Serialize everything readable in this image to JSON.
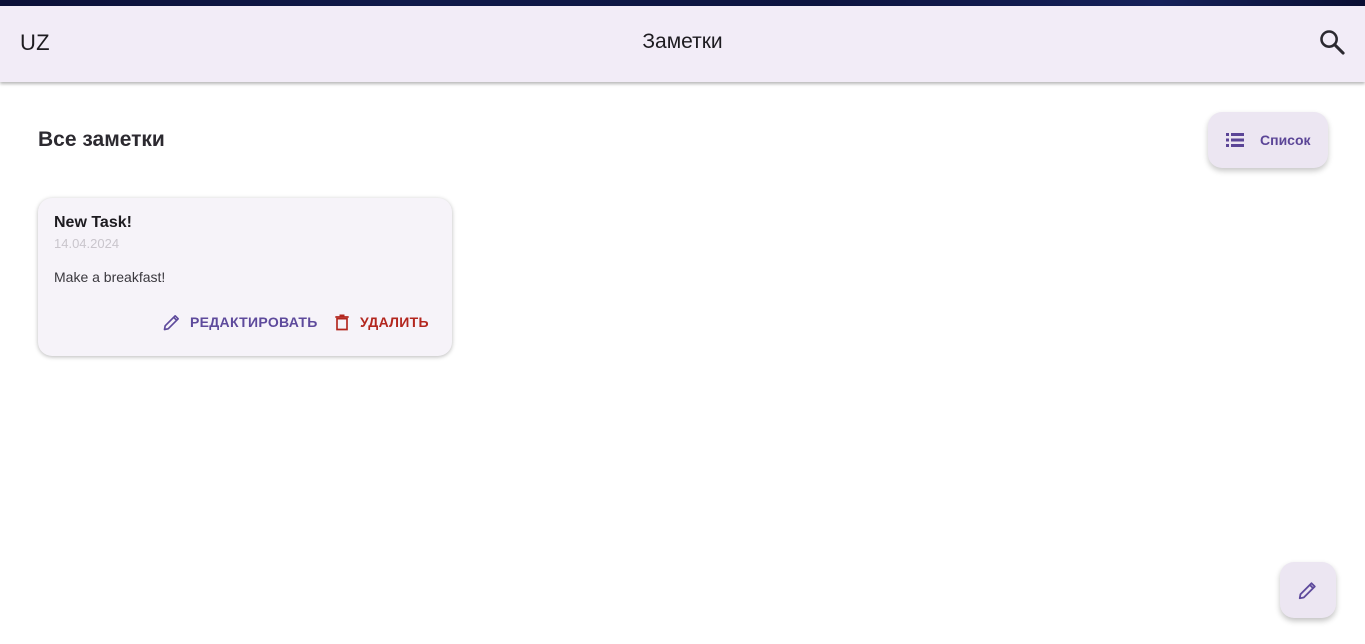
{
  "app_bar": {
    "logo": "UZ",
    "title": "Заметки",
    "search_icon": "search-icon"
  },
  "section": {
    "title": "Все заметки"
  },
  "view_toggle": {
    "icon": "list-icon",
    "label": "Список"
  },
  "notes": [
    {
      "title": "New Task!",
      "date": "14.04.2024",
      "text": "Make a breakfast!",
      "edit_label": "РЕДАКТИРОВАТЬ",
      "delete_label": "УДАЛИТЬ"
    }
  ],
  "fab": {
    "icon": "pencil-icon"
  },
  "colors": {
    "app_bar_bg": "#f2ecf7",
    "accent": "#5e4a9c",
    "danger": "#b3261e",
    "card_bg": "#f6f3f9"
  }
}
